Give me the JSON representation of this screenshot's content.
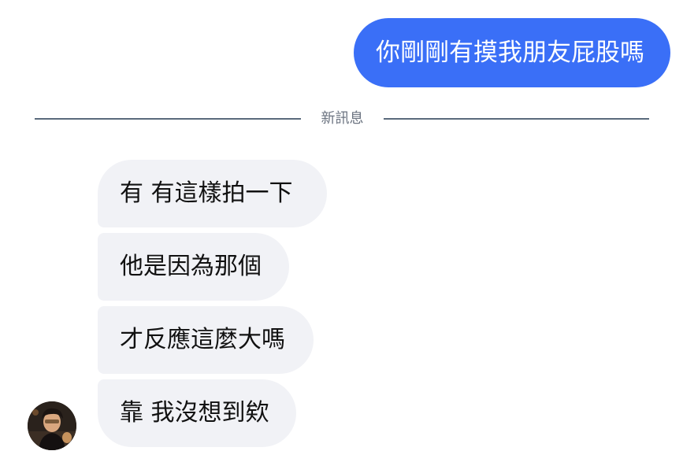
{
  "conversation": {
    "outgoing_message": "你剛剛有摸我朋友屁股嗎",
    "divider_label": "新訊息",
    "incoming_messages": [
      "有  有這樣拍一下",
      "他是因為那個",
      "才反應這麼大嗎",
      "靠 我沒想到欸"
    ]
  },
  "contact": {
    "avatar_icon": "person-avatar-icon"
  },
  "colors": {
    "outgoing_bubble": "#3a6ff7",
    "incoming_bubble": "#f1f2f6",
    "divider": "#5a6a7c"
  }
}
